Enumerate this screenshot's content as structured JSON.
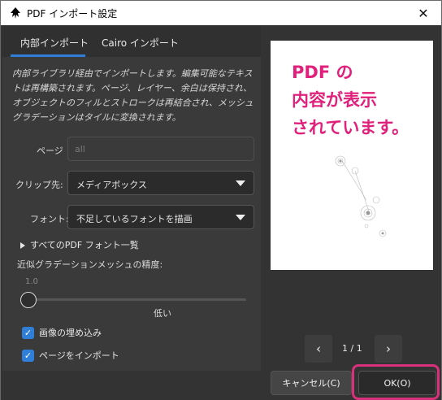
{
  "window": {
    "title": "PDF インポート設定",
    "close_glyph": "✕"
  },
  "tabs": [
    {
      "label": "内部インポート",
      "active": true
    },
    {
      "label": "Cairo インポート",
      "active": false
    }
  ],
  "description": "内部ライブラリ経由でインポートします。編集可能なテキストは再構築されます。ページ、レイヤー、余白は保持され、オブジェクトのフィルとストロークは再結合され、メッシュグラデーションはタイルに変換されます。",
  "page": {
    "label": "ページ",
    "placeholder": "all"
  },
  "clip": {
    "label": "クリップ先:",
    "value": "メディアボックス"
  },
  "font": {
    "label": "フォント:",
    "value": "不足しているフォントを描画"
  },
  "font_list_expander": "すべてのPDF フォント一覧",
  "precision": {
    "label": "近似グラデーションメッシュの精度:",
    "value": "1.0",
    "caption": "低い",
    "level_fraction": 0
  },
  "checkboxes": [
    {
      "label": "画像の埋め込み",
      "checked": true
    },
    {
      "label": "ページをインポート",
      "checked": true
    }
  ],
  "preview": {
    "annotation": "PDF の\n内容が表示\nされています。"
  },
  "pager": {
    "text": "1 / 1",
    "prev_glyph": "‹",
    "next_glyph": "›"
  },
  "buttons": {
    "cancel": "キャンセル(C)",
    "ok": "OK(O)"
  },
  "colors": {
    "accent": "#2f7fd8",
    "annotation": "#e0207a",
    "highlight": "#d8307a"
  }
}
